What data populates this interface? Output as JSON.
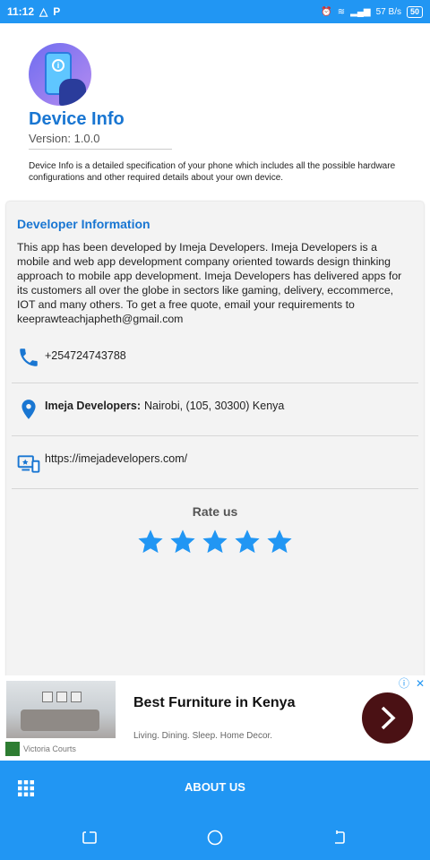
{
  "statusbar": {
    "time": "11:12",
    "net_speed": "57 B/s",
    "battery": "50"
  },
  "header": {
    "app_title": "Device Info",
    "version": "Version: 1.0.0",
    "description": "Device Info is a detailed specification of your phone which includes all the possible hardware configurations and other required details about your own device."
  },
  "developer": {
    "title": "Developer Information",
    "body": "This app has been developed by Imeja Developers. Imeja Developers is a mobile and web app development company oriented towards design thinking approach to mobile app development. Imeja Developers has delivered apps for its customers all over the globe in sectors like gaming, delivery, eccommerce, IOT and many others. To get a free quote, email your requirements to keeprawteachjapheth@gmail.com",
    "phone": "+254724743788",
    "company": "Imeja Developers:",
    "address": "Nairobi, (105, 30300) Kenya",
    "website": "https://imejadevelopers.com/"
  },
  "rating": {
    "label": "Rate us",
    "stars": 5,
    "star_color": "#2196f3"
  },
  "ad": {
    "title": "Best Furniture in Kenya",
    "subtitle": "Living. Dining. Sleep. Home Decor.",
    "brand": "Victoria Courts"
  },
  "bottombar": {
    "label": "ABOUT US"
  },
  "colors": {
    "primary": "#2196f3",
    "title_blue": "#1976d2"
  }
}
